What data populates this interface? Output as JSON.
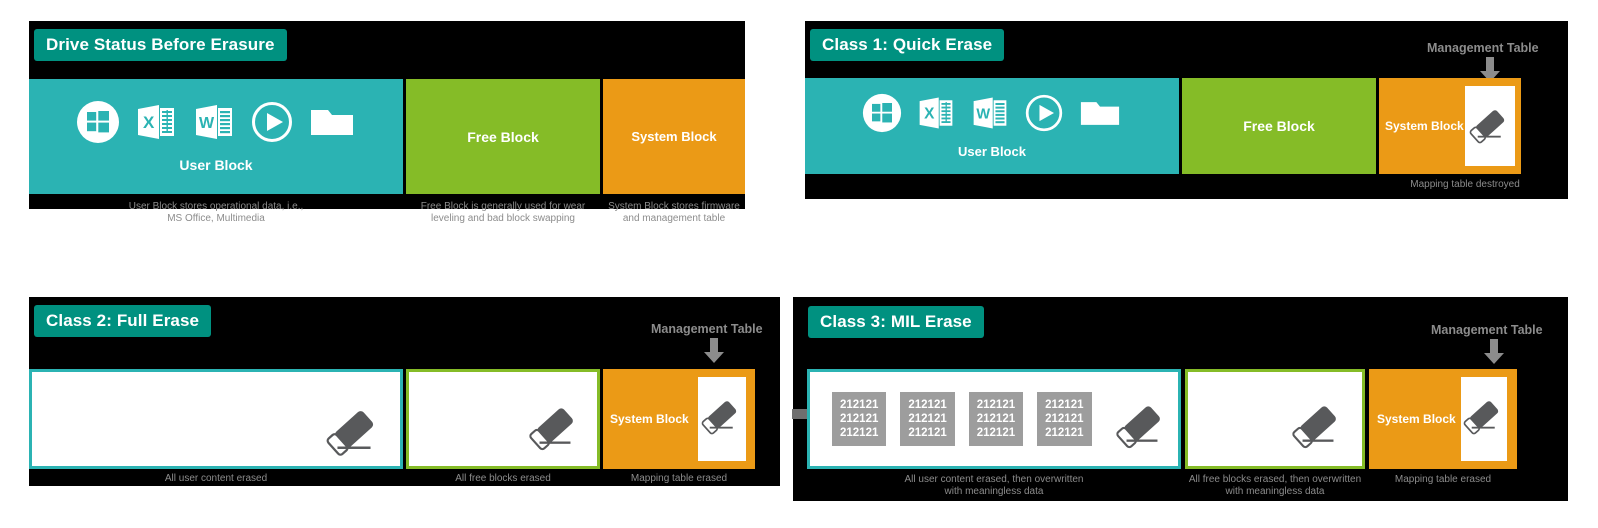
{
  "theme": {
    "badge_color": "#009180",
    "user_block_color": "#2BB3B3",
    "free_block_color": "#85BC27",
    "system_block_color": "#EB9A16",
    "panel_bg": "#000000",
    "caption_color": "#8c8c8c",
    "chip_color": "#9d9d9d",
    "eraser_color": "#58595B"
  },
  "panels": [
    {
      "id": "before",
      "title": "Drive Status Before Erasure",
      "user_block": {
        "label": "User Block",
        "caption": "User Block stores operational data, i.e.,\nMS Office, Multimedia",
        "icons": [
          "windows-icon",
          "excel-icon",
          "word-icon",
          "media-player-icon",
          "folder-icon"
        ]
      },
      "free_block": {
        "label": "Free Block",
        "caption": "Free Block is generally used for wear\nleveling and bad block swapping"
      },
      "system_block": {
        "label": "System Block",
        "caption": "System Block stores firmware\nand management table"
      }
    },
    {
      "id": "class1",
      "title": "Class 1: Quick Erase",
      "management_table_label": "Management Table",
      "user_block": {
        "label": "User Block",
        "caption": "",
        "icons": [
          "windows-icon",
          "excel-icon",
          "word-icon",
          "media-player-icon",
          "folder-icon"
        ]
      },
      "free_block": {
        "label": "Free Block",
        "caption": ""
      },
      "system_block": {
        "label": "System Block",
        "caption": "Mapping table destroyed"
      }
    },
    {
      "id": "class2",
      "title": "Class 2: Full Erase",
      "management_table_label": "Management Table",
      "user_block": {
        "label": "",
        "caption": "All user content erased"
      },
      "free_block": {
        "label": "",
        "caption": "All free blocks erased"
      },
      "system_block": {
        "label": "System Block",
        "caption": "Mapping table erased"
      }
    },
    {
      "id": "class3",
      "title": "Class 3: MIL Erase",
      "management_table_label": "Management Table",
      "user_block": {
        "label": "",
        "caption": "All user content erased, then overwritten\nwith meaningless data",
        "chips": [
          "212121\n212121\n212121",
          "212121\n212121\n212121",
          "212121\n212121\n212121",
          "212121\n212121\n212121"
        ]
      },
      "free_block": {
        "label": "",
        "caption": "All free blocks erased, then overwritten\nwith meaningless data"
      },
      "system_block": {
        "label": "System Block",
        "caption": "Mapping table erased"
      }
    }
  ]
}
